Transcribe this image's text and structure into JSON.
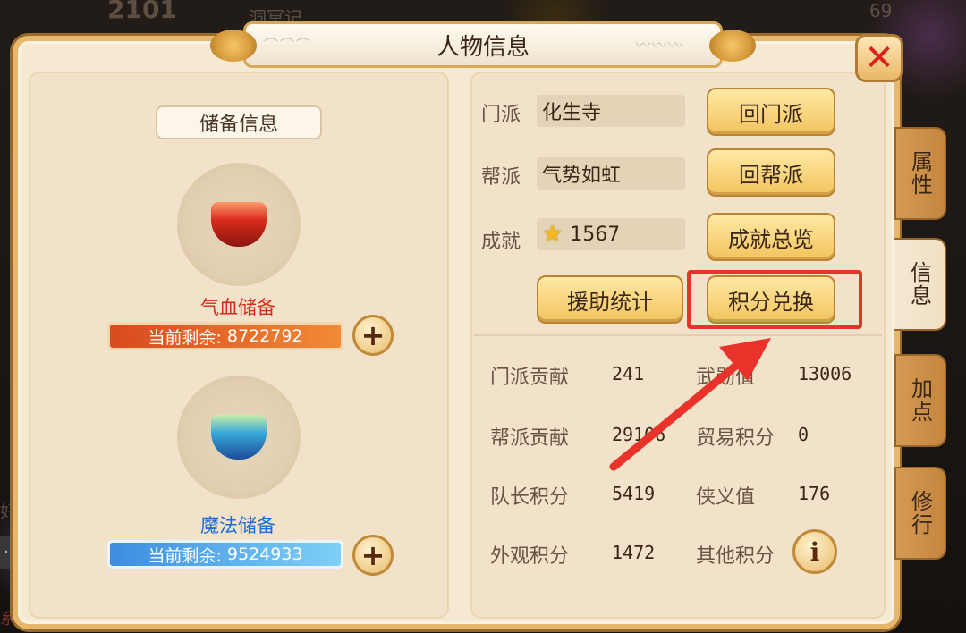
{
  "background": {
    "top_text": "洞冥记",
    "top_number": "2101",
    "top_right_number": "69",
    "left_text": "好友",
    "bottom_left_text": "系统"
  },
  "window": {
    "title": "人物信息"
  },
  "left": {
    "header": "储备信息",
    "hp_reserve": {
      "label": "气血储备",
      "remaining_label": "当前剩余:",
      "value": "8722792"
    },
    "mp_reserve": {
      "label": "魔法储备",
      "remaining_label": "当前剩余:",
      "value": "9524933"
    }
  },
  "right": {
    "sect_label": "门派",
    "sect_value": "化生寺",
    "guild_label": "帮派",
    "guild_value": "气势如虹",
    "achievement_label": "成就",
    "achievement_value": "1567",
    "buttons": {
      "return_sect": "回门派",
      "return_guild": "回帮派",
      "achievement_overview": "成就总览",
      "assist_stats": "援助统计",
      "points_exchange": "积分兑换"
    },
    "stats": [
      {
        "label": "门派贡献",
        "value": "241"
      },
      {
        "label": "武勋值",
        "value": "13006"
      },
      {
        "label": "帮派贡献",
        "value": "29106"
      },
      {
        "label": "贸易积分",
        "value": "0"
      },
      {
        "label": "队长积分",
        "value": "5419"
      },
      {
        "label": "侠义值",
        "value": "176"
      },
      {
        "label": "外观积分",
        "value": "1472"
      },
      {
        "label": "其他积分",
        "value": ""
      }
    ]
  },
  "tabs": [
    {
      "label": "属性",
      "active": false
    },
    {
      "label": "信息",
      "active": true
    },
    {
      "label": "加点",
      "active": false
    },
    {
      "label": "修行",
      "active": false
    }
  ],
  "colors": {
    "highlight": "#e8322a",
    "hp_bar": "#e0561f",
    "mp_bar": "#4a9ae4",
    "hp_label": "#d8281c",
    "mp_label": "#1a6fd6"
  }
}
